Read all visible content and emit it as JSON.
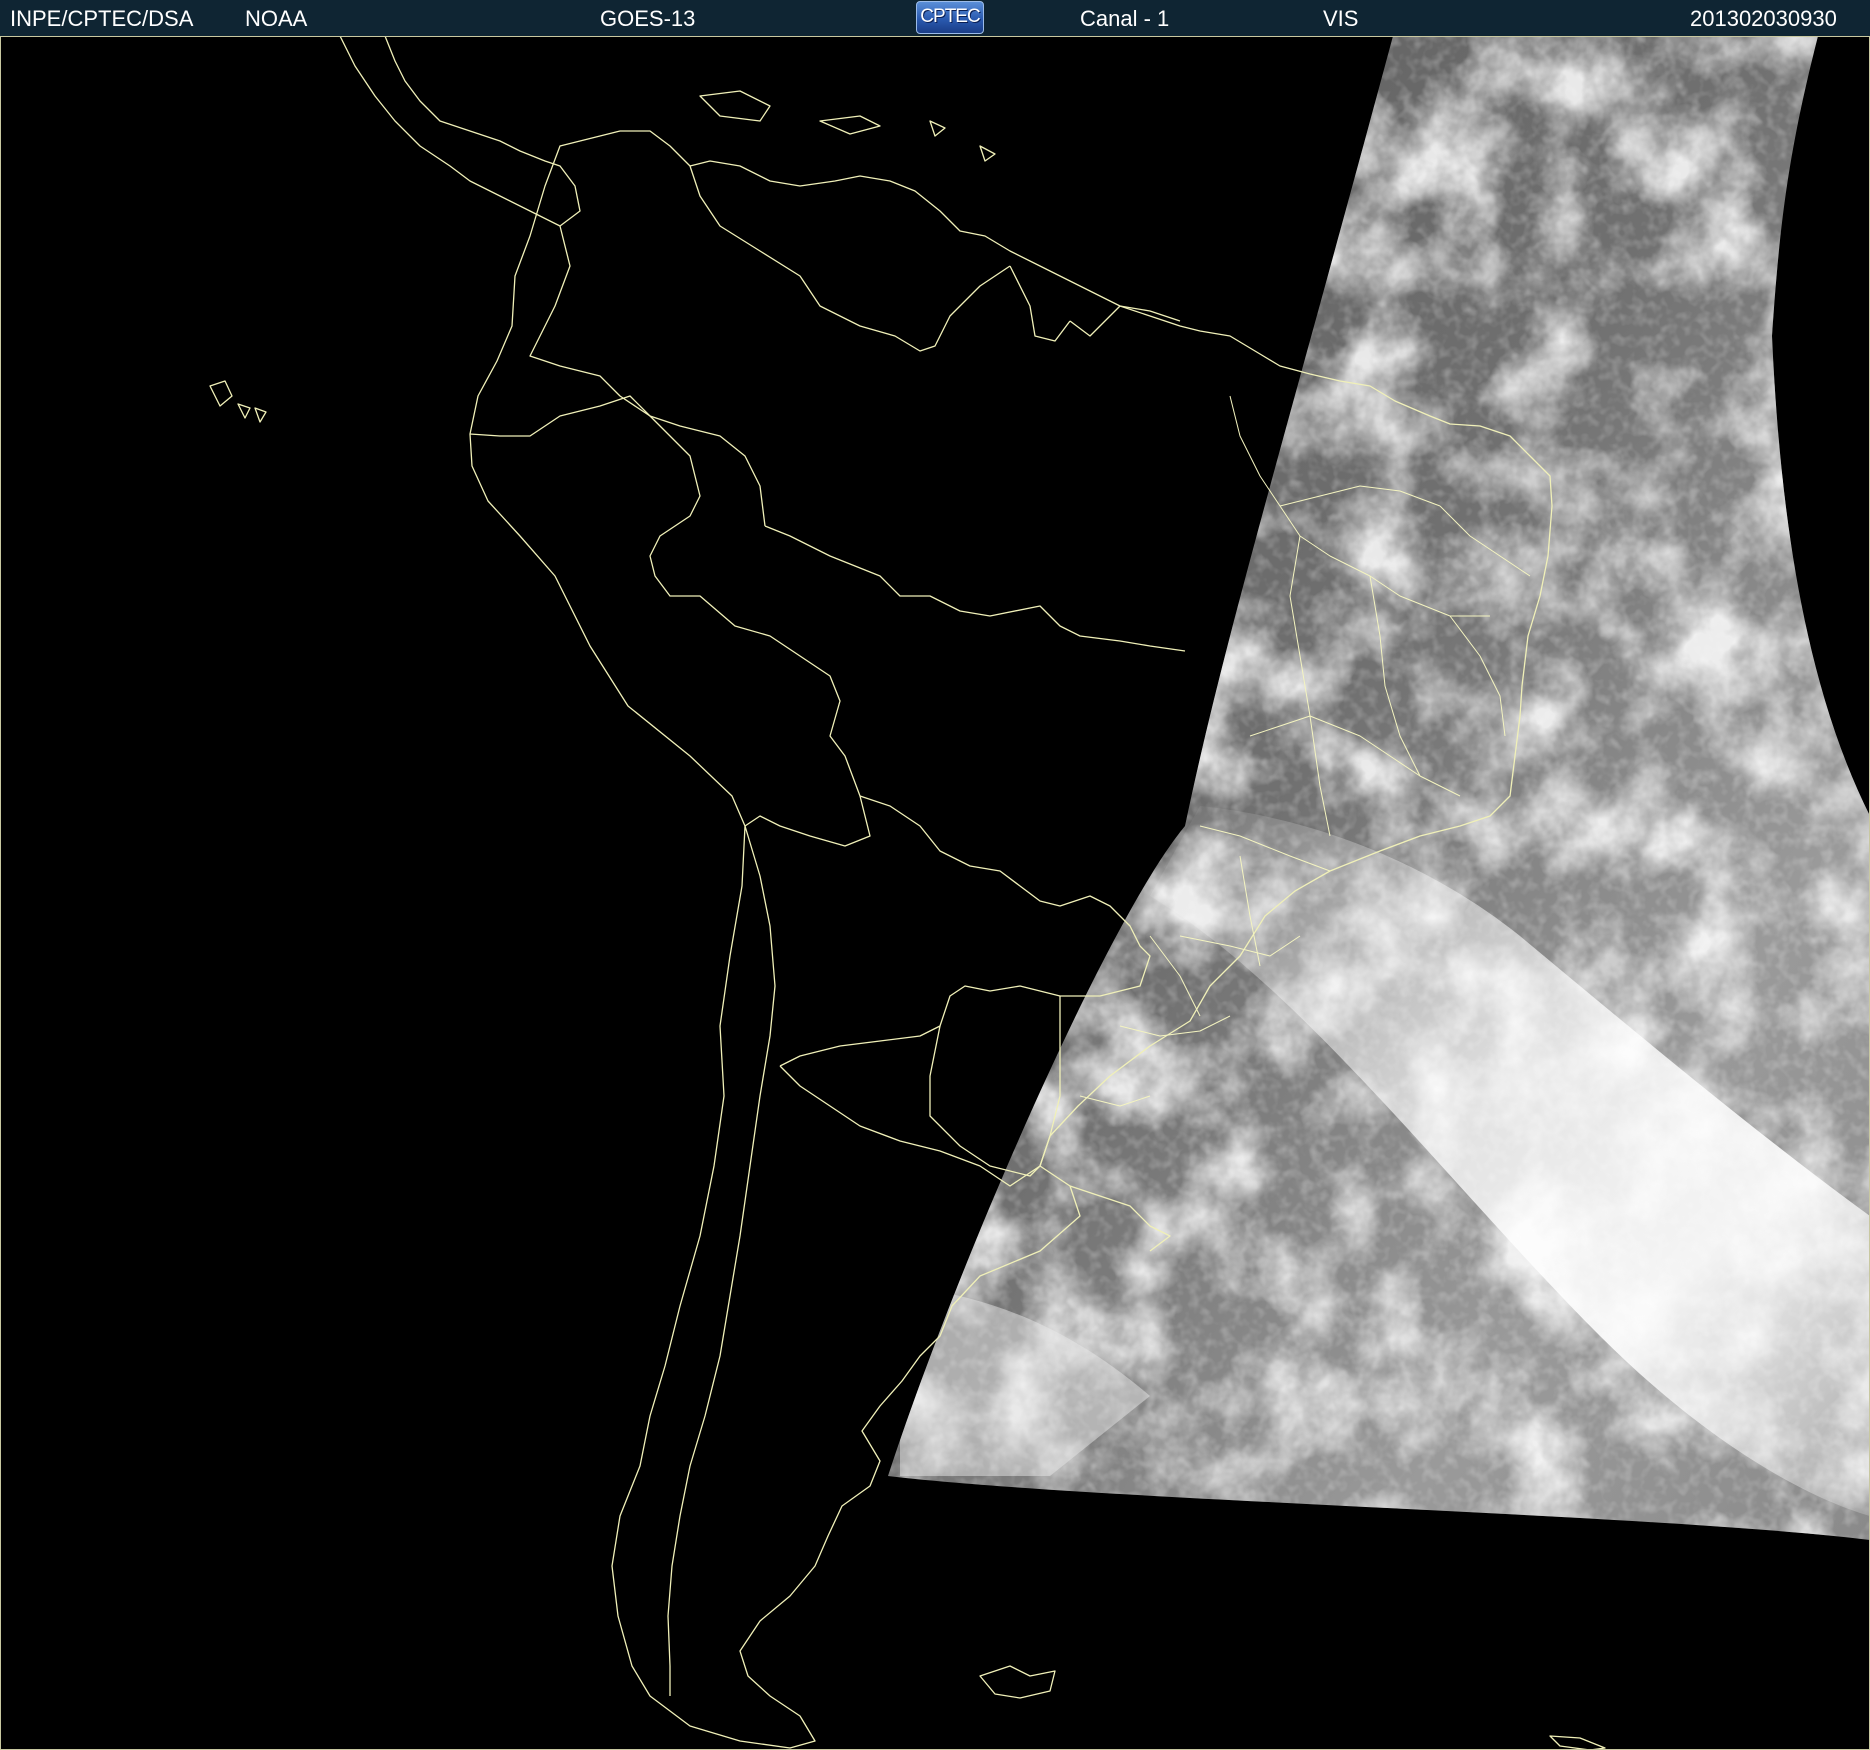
{
  "header": {
    "institution": "INPE/CPTEC/DSA",
    "agency": "NOAA",
    "satellite": "GOES-13",
    "logo_text": "CPTEC",
    "channel": "Canal - 1",
    "band": "VIS",
    "timestamp": "201302030930"
  },
  "map": {
    "region": "South America",
    "boundary_color": "#f0f0b8",
    "background_color": "#000000",
    "imagery": "visible channel daylight swath over eastern South America and South Atlantic"
  }
}
